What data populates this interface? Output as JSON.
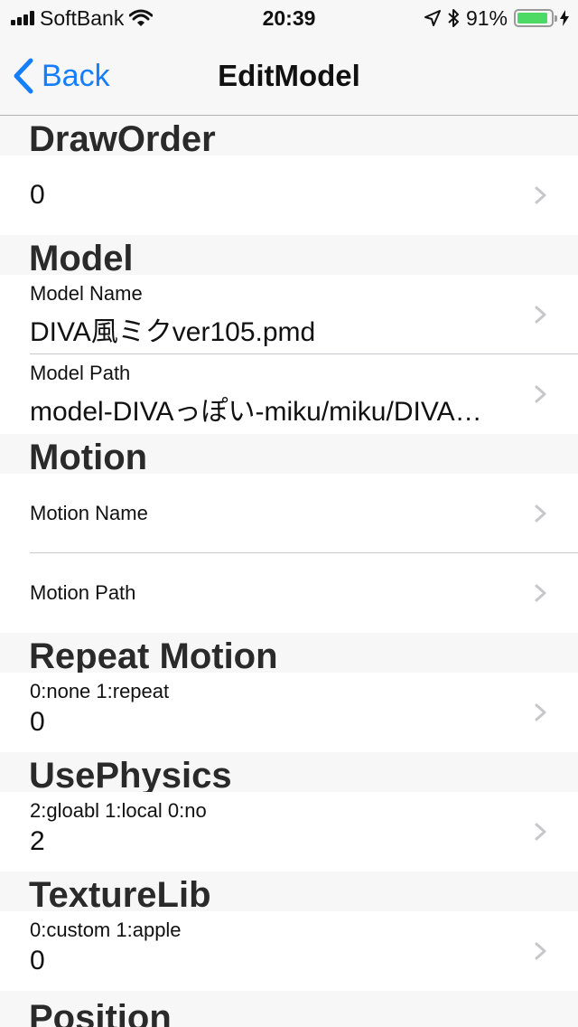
{
  "status": {
    "carrier": "SoftBank",
    "time": "20:39",
    "battery": "91%",
    "battery_level": 0.91
  },
  "nav": {
    "back_label": "Back",
    "title": "EditModel"
  },
  "sections": {
    "draw_order": {
      "header": "DrawOrder",
      "value": "0"
    },
    "model": {
      "header": "Model",
      "name_label": "Model Name",
      "name_value": "DIVA風ミクver105.pmd",
      "path_label": "Model Path",
      "path_value": "model-DIVAっぽい-miku/miku/DIVA…"
    },
    "motion": {
      "header": "Motion",
      "name_label": "Motion Name",
      "path_label": "Motion Path"
    },
    "repeat_motion": {
      "header": "Repeat Motion",
      "hint": "0:none 1:repeat",
      "value": "0"
    },
    "use_physics": {
      "header": "UsePhysics",
      "hint": "2:gloabl 1:local 0:no",
      "value": "2"
    },
    "texture_lib": {
      "header": "TextureLib",
      "hint": "0:custom 1:apple",
      "value": "0"
    },
    "position": {
      "header": "Position"
    }
  }
}
